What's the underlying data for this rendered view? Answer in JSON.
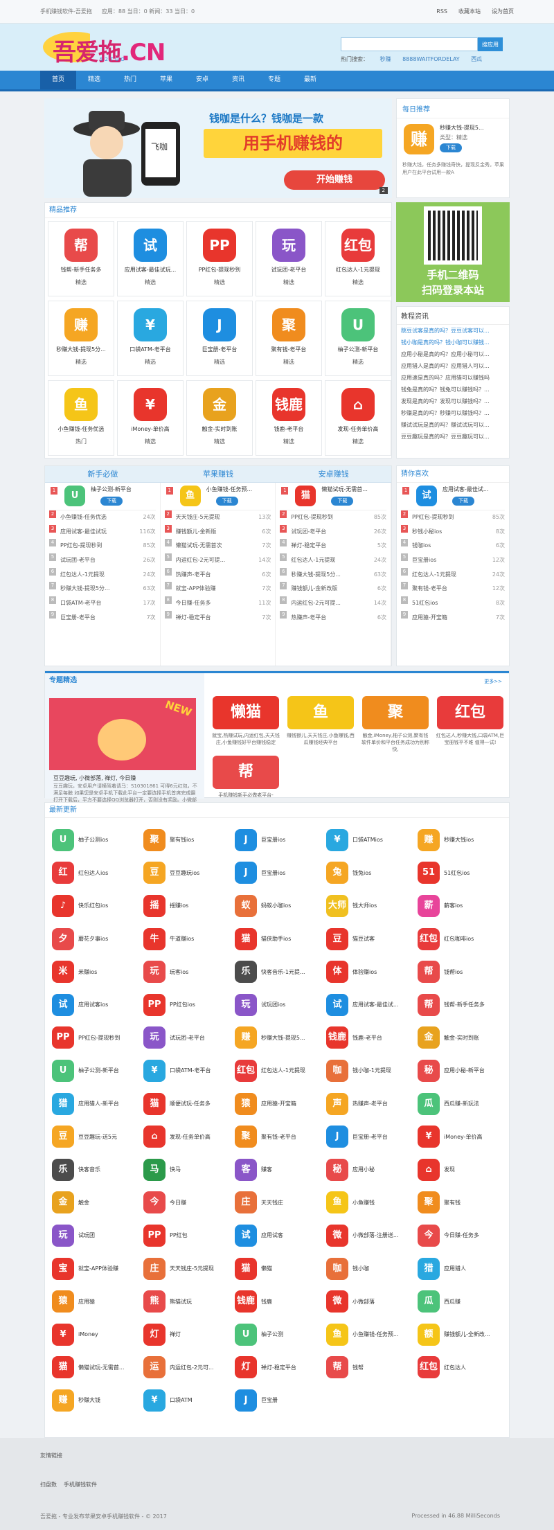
{
  "topbar": {
    "site": "手机赚钱软件-吾爱拖",
    "stats": "应用：88 当日：0 新闻：33 当日：0",
    "links": [
      "RSS",
      "收藏本站",
      "设为首页"
    ]
  },
  "logo": {
    "main": "吾爱拖",
    "cn": ".CN",
    "sub": "52TUO"
  },
  "search": {
    "placeholder": "",
    "button": "搜应用",
    "hot_label": "热门搜索：",
    "hot": [
      "秒赚",
      "8888WAITFORDELAY",
      "西瓜"
    ]
  },
  "nav": [
    "首页",
    "精选",
    "热门",
    "苹果",
    "安卓",
    "资讯",
    "专题",
    "最新"
  ],
  "banner": {
    "h1": "钱咖是什么？钱咖是一款",
    "h2": "用手机赚钱的",
    "go": "开始赚钱",
    "page": "2"
  },
  "daily": {
    "title": "每日推荐",
    "name": "秒赚大钱-提现5...",
    "cat": "类型：精选",
    "down": "下载",
    "desc": "秒赚大钱，任务多赚钱奇快，提现反金秀。苹果用户在此平台试用一款A",
    "icon": "赚"
  },
  "qr": {
    "a": "手机二维码",
    "b": "扫码登录本站"
  },
  "tutorial": {
    "title": "教程资讯",
    "items": [
      "跳豆试客是真的吗？豆豆试客可以...",
      "钱小咖是真的吗？钱小咖可以赚钱...",
      "应用小秘是真的吗？应用小秘可以...",
      "应用猎人是真的吗？应用猎人可以...",
      "应用速是真的吗？应用猎可以赚钱吗",
      "钱兔是真的吗？钱兔可以赚钱吗？...",
      "发现是真的吗？发现可以赚钱吗？...",
      "秒赚是真的吗？秒赚可以赚钱吗？...",
      "赚试试玩是真的吗？赚试试玩可以...",
      "豆豆趣玩是真的吗？豆豆趣玩可以..."
    ]
  },
  "pick": {
    "title": "精品推荐",
    "items": [
      {
        "n": "钱帮-新手任务多",
        "t": "精选",
        "i": "帮",
        "c": "#e84a4a"
      },
      {
        "n": "应用试客-最佳试玩...",
        "t": "精选",
        "i": "试",
        "c": "#1e8ee0"
      },
      {
        "n": "PP红包-提现秒到",
        "t": "精选",
        "i": "PP",
        "c": "#e8352c"
      },
      {
        "n": "试玩团-老平台",
        "t": "精选",
        "i": "玩",
        "c": "#8a56c8"
      },
      {
        "n": "红包达人-1元提现",
        "t": "精选",
        "i": "红包",
        "c": "#e83b3b"
      },
      {
        "n": "秒赚大钱-提现5分...",
        "t": "精选",
        "i": "赚",
        "c": "#f5a623"
      },
      {
        "n": "口袋ATM-老平台",
        "t": "精选",
        "i": "¥",
        "c": "#29a8e0"
      },
      {
        "n": "巨宝册-老平台",
        "t": "精选",
        "i": "J",
        "c": "#1e8ee0"
      },
      {
        "n": "聚有钱-老平台",
        "t": "精选",
        "i": "聚",
        "c": "#f08c1e"
      },
      {
        "n": "柚子公测-新平台",
        "t": "精选",
        "i": "U",
        "c": "#4cc37a"
      },
      {
        "n": "小鱼赚钱-任务优选",
        "t": "热门",
        "i": "鱼",
        "c": "#f5c518"
      },
      {
        "n": "iMoney-单价高",
        "t": "精选",
        "i": "¥",
        "c": "#e8352c"
      },
      {
        "n": "触金-实时到账",
        "t": "精选",
        "i": "金",
        "c": "#e8a21e"
      },
      {
        "n": "钱鹿-老平台",
        "t": "精选",
        "i": "钱鹿",
        "c": "#e8352c"
      },
      {
        "n": "发现-任务单价高",
        "t": "精选",
        "i": "⌂",
        "c": "#e8352c"
      }
    ]
  },
  "tabs": [
    "新手必做",
    "苹果赚钱",
    "安卓赚钱"
  ],
  "lists": [
    {
      "top": {
        "n": "柚子公测-新平台",
        "i": "U",
        "c": "#4cc37a"
      },
      "rows": [
        [
          "小鱼赚钱-任务优选",
          "24次"
        ],
        [
          "应用试客-最佳试玩",
          "116次"
        ],
        [
          "PP红包-提现秒到",
          "85次"
        ],
        [
          "试玩团-老平台",
          "26次"
        ],
        [
          "红包达人-1元提现",
          "24次"
        ],
        [
          "秒赚大钱-提现5分...",
          "63次"
        ],
        [
          "口袋ATM-老平台",
          "17次"
        ],
        [
          "巨宝册-老平台",
          "7次"
        ]
      ]
    },
    {
      "top": {
        "n": "小鱼赚钱-任务预...",
        "i": "鱼",
        "c": "#f5c518"
      },
      "rows": [
        [
          "天天钱庄-5元提现",
          "13次"
        ],
        [
          "赚钱额儿-金新版",
          "6次"
        ],
        [
          "懒猫试玩-无需首次",
          "7次"
        ],
        [
          "内运红包-2元可提...",
          "14次"
        ],
        [
          "热赚声-老平台",
          "6次"
        ],
        [
          "就宝-APP体验赚",
          "7次"
        ],
        [
          "今日赚-任务多",
          "11次"
        ],
        [
          "禅灯-稳定平台",
          "7次"
        ]
      ]
    },
    {
      "top": {
        "n": "懒猫试玩-无需首...",
        "i": "猫",
        "c": "#e8352c"
      },
      "rows": [
        [
          "PP红包-提现秒到",
          "85次"
        ],
        [
          "试玩团-老平台",
          "26次"
        ],
        [
          "禅灯-稳定平台",
          "5次"
        ],
        [
          "红包达人-1元提现",
          "24次"
        ],
        [
          "秒赚大钱-提现5分...",
          "63次"
        ],
        [
          "赚钱额儿-金新改版",
          "6次"
        ],
        [
          "内运红包-2元可提...",
          "14次"
        ],
        [
          "热赚声-老平台",
          "6次"
        ]
      ]
    }
  ],
  "guess": {
    "title": "猜你喜欢",
    "top": {
      "n": "应用试客-最佳试...",
      "i": "试",
      "c": "#1e8ee0"
    },
    "rows": [
      [
        "PP红包-提现秒到",
        "85次"
      ],
      [
        "秒钱小秘ios",
        "8次"
      ],
      [
        "钱咖ios",
        "6次"
      ],
      [
        "巨宝册ios",
        "12次"
      ],
      [
        "红包达人-1元提现",
        "24次"
      ],
      [
        "聚有钱-老平台",
        "12次"
      ],
      [
        "51红包ios",
        "8次"
      ],
      [
        "应用猿-开宝箱",
        "7次"
      ]
    ]
  },
  "topic": {
    "title": "专题精选",
    "more": "更多>>",
    "new": "NEW",
    "main_title": "豆豆趣玩, 小微部落, 禅灯, 今日赚",
    "main_desc": "豆豆趣玩，安卓用户请横驾着请马：S10301861 可得6元红包，不满足每触 如果您是安卓手机下载此平台一定要选择手机首席完成翻打开下载后，平方不要选择QQ浏览器打开，否则没有奖励。小微部落，苹果用户在此平台",
    "items": [
      {
        "t": "就宝,热赚试玩,内运红包,天天钱庄,小鱼赚钱好平台赚钱稳定",
        "i": "懒猫",
        "c": "#e8352c"
      },
      {
        "t": "赚钱额儿,天天钱庄,小鱼赚钱,西瓜赚钱经典平台",
        "i": "鱼",
        "c": "#f5c518"
      },
      {
        "t": "触金,iMoney,柚子公测,聚有钱软件单价和平台任务成功为别称快,",
        "i": "聚",
        "c": "#f08c1e"
      },
      {
        "t": "红包达人,秒赚大钱,口袋ATM,巨宝册钱平不难 值得一试!",
        "i": "红包",
        "c": "#e83b3b"
      },
      {
        "t": "手机赚钱新手必做老平台-",
        "i": "帮",
        "c": "#e84a4a"
      }
    ]
  },
  "recent": {
    "title": "最新更新",
    "items": [
      [
        "柚子公测ios",
        "U",
        "#4cc37a"
      ],
      [
        "聚有钱ios",
        "聚",
        "#f08c1e"
      ],
      [
        "巨宝册ios",
        "J",
        "#1e8ee0"
      ],
      [
        "口袋ATMios",
        "¥",
        "#29a8e0"
      ],
      [
        "秒赚大钱ios",
        "赚",
        "#f5a623"
      ],
      [
        "红包达人ios",
        "红",
        "#e83b3b"
      ],
      [
        "豆豆趣玩ios",
        "豆",
        "#f5a623"
      ],
      [
        "巨宝册ios",
        "J",
        "#1e8ee0"
      ],
      [
        "钱兔ios",
        "兔",
        "#f5a623"
      ],
      [
        "51红包ios",
        "51",
        "#e8352c"
      ],
      [
        "快乐红包ios",
        "♪",
        "#e8352c"
      ],
      [
        "摇赚ios",
        "摇",
        "#e8352c"
      ],
      [
        "蚂蚁小咖ios",
        "蚁",
        "#e8703a"
      ],
      [
        "钱大师ios",
        "大师",
        "#f0c020"
      ],
      [
        "薪客ios",
        "薪",
        "#e8449a"
      ],
      [
        "蘑花夕事ios",
        "夕",
        "#e84a4a"
      ],
      [
        "牛道赚ios",
        "牛",
        "#e8352c"
      ],
      [
        "猫侠助手ios",
        "猫",
        "#e8352c"
      ],
      [
        "猫豆试客",
        "豆",
        "#e8352c"
      ],
      [
        "红包咖啡ios",
        "红包",
        "#e83b3b"
      ],
      [
        "米赚ios",
        "米",
        "#e8352c"
      ],
      [
        "玩客ios",
        "玩",
        "#e84a4a"
      ],
      [
        "快客音乐-1元提...",
        "乐",
        "#4c4c4c"
      ],
      [
        "体验赚ios",
        "体",
        "#e8352c"
      ],
      [
        "钱帮ios",
        "帮",
        "#e84a4a"
      ],
      [
        "应用试客ios",
        "试",
        "#1e8ee0"
      ],
      [
        "PP红包ios",
        "PP",
        "#e8352c"
      ],
      [
        "试玩团ios",
        "玩",
        "#8a56c8"
      ],
      [
        "应用试客-最佳试...",
        "试",
        "#1e8ee0"
      ],
      [
        "钱帮-新手任务多",
        "帮",
        "#e84a4a"
      ],
      [
        "PP红包-提现秒到",
        "PP",
        "#e8352c"
      ],
      [
        "试玩团-老平台",
        "玩",
        "#8a56c8"
      ],
      [
        "秒赚大钱-提现5...",
        "赚",
        "#f5a623"
      ],
      [
        "钱鹿-老平台",
        "钱鹿",
        "#e8352c"
      ],
      [
        "触金-实时到账",
        "金",
        "#e8a21e"
      ],
      [
        "柚子公测-新平台",
        "U",
        "#4cc37a"
      ],
      [
        "口袋ATM-老平台",
        "¥",
        "#29a8e0"
      ],
      [
        "红包达人-1元提现",
        "红包",
        "#e83b3b"
      ],
      [
        "钱小咖-1元提现",
        "咖",
        "#e8703a"
      ],
      [
        "应用小秘-新平台",
        "秘",
        "#e84a4a"
      ],
      [
        "应用猎人-新平台",
        "猎",
        "#29a8e0"
      ],
      [
        "顺便试玩-任务多",
        "猫",
        "#e8352c"
      ],
      [
        "应用猿-开宝箱",
        "猿",
        "#f08c1e"
      ],
      [
        "热赚声-老平台",
        "声",
        "#f5a623"
      ],
      [
        "西瓜赚-新玩法",
        "瓜",
        "#4cc37a"
      ],
      [
        "豆豆趣玩-送5元",
        "豆",
        "#f5a623"
      ],
      [
        "发现-任务单价高",
        "⌂",
        "#e8352c"
      ],
      [
        "聚有钱-老平台",
        "聚",
        "#f08c1e"
      ],
      [
        "巨宝册-老平台",
        "J",
        "#1e8ee0"
      ],
      [
        "iMoney-单价高",
        "¥",
        "#e8352c"
      ],
      [
        "快客音乐",
        "乐",
        "#4c4c4c"
      ],
      [
        "快马",
        "马",
        "#2b9a4a"
      ],
      [
        "赚客",
        "客",
        "#8a56c8"
      ],
      [
        "应用小秘",
        "秘",
        "#e84a4a"
      ],
      [
        "发现",
        "⌂",
        "#e8352c"
      ],
      [
        "触金",
        "金",
        "#e8a21e"
      ],
      [
        "今日赚",
        "今",
        "#e84a4a"
      ],
      [
        "天天钱庄",
        "庄",
        "#e8703a"
      ],
      [
        "小鱼赚钱",
        "鱼",
        "#f5c518"
      ],
      [
        "聚有钱",
        "聚",
        "#f08c1e"
      ],
      [
        "试玩团",
        "玩",
        "#8a56c8"
      ],
      [
        "PP红包",
        "PP",
        "#e8352c"
      ],
      [
        "应用试客",
        "试",
        "#1e8ee0"
      ],
      [
        "小微部落-注册送...",
        "微",
        "#e8352c"
      ],
      [
        "今日赚-任务多",
        "今",
        "#e84a4a"
      ],
      [
        "就宝-APP体验赚",
        "宝",
        "#e8352c"
      ],
      [
        "天天钱庄-5元提现",
        "庄",
        "#e8703a"
      ],
      [
        "懒猫",
        "猫",
        "#e8352c"
      ],
      [
        "钱小咖",
        "咖",
        "#e8703a"
      ],
      [
        "应用猎人",
        "猎",
        "#29a8e0"
      ],
      [
        "应用猿",
        "猿",
        "#f08c1e"
      ],
      [
        "熊猫试玩",
        "熊",
        "#e84a4a"
      ],
      [
        "钱鹿",
        "钱鹿",
        "#e8352c"
      ],
      [
        "小微部落",
        "微",
        "#e8352c"
      ],
      [
        "西瓜赚",
        "瓜",
        "#4cc37a"
      ],
      [
        "iMoney",
        "¥",
        "#e8352c"
      ],
      [
        "禅灯",
        "灯",
        "#e8352c"
      ],
      [
        "柚子公测",
        "U",
        "#4cc37a"
      ],
      [
        "小鱼赚钱-任务预...",
        "鱼",
        "#f5c518"
      ],
      [
        "赚钱额儿-全新改...",
        "额",
        "#f5c518"
      ],
      [
        "懒猫试玩-无需首...",
        "猫",
        "#e8352c"
      ],
      [
        "内运红包-2元可...",
        "运",
        "#e8703a"
      ],
      [
        "禅灯-稳定平台",
        "灯",
        "#e8352c"
      ],
      [
        "钱帮",
        "帮",
        "#e84a4a"
      ],
      [
        "红包达人",
        "红包",
        "#e83b3b"
      ],
      [
        "秒赚大钱",
        "赚",
        "#f5a623"
      ],
      [
        "口袋ATM",
        "¥",
        "#29a8e0"
      ],
      [
        "巨宝册",
        "J",
        "#1e8ee0"
      ]
    ]
  },
  "footer": {
    "links_title": "友情链接",
    "links": [
      "扫盘数",
      "手机赚钱软件"
    ],
    "copy": "吾爱拖 - 专业发布苹果安卓手机赚钱软件 - © 2017",
    "proc": "Processed in 46.88 MilliSeconds"
  },
  "ui": {
    "down": "下载"
  }
}
